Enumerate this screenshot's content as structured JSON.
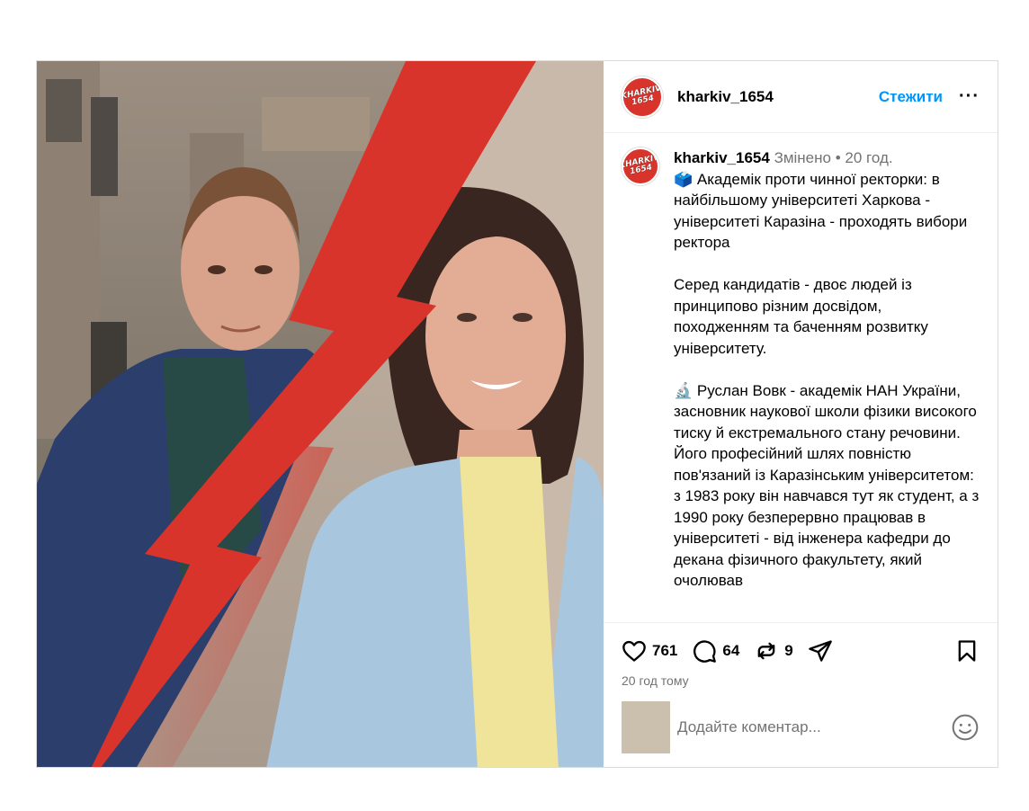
{
  "post": {
    "username": "kharkiv_1654",
    "follow_label": "Стежити",
    "more_label": "···",
    "avatar_text": "KHARKIV 1654",
    "caption": {
      "username": "kharkiv_1654",
      "edited": "Змінено",
      "separator": "•",
      "time": "20 год.",
      "emoji1": "🗳️",
      "paragraph1": " Академік проти чинної ректорки: в найбільшому університеті Харкова - університеті Каразіна - проходять вибори ректора",
      "paragraph2": "Серед кандидатів - двоє людей із принципово різним досвідом, походженням та баченням розвитку університету.",
      "emoji2": "🔬",
      "paragraph3": " Руслан Вовк - академік НАН України, засновник наукової школи фізики високого тиску й екстремального стану речовини. Його професійний шлях повністю пов'язаний із Каразінським університетом: з 1983 року він навчався тут як студент, а з 1990 року безперервно працював в університеті - від інженера кафедри до декана фізичного факультету, який очолював"
    },
    "likes": "761",
    "comments": "64",
    "reposts": "9",
    "time_ago": "20 год тому",
    "comment_placeholder": "Додайте коментар..."
  },
  "colors": {
    "accent": "#0095f6",
    "bolt": "#d9342b",
    "muted": "#737373"
  },
  "icons": [
    "heart-icon",
    "comment-icon",
    "repost-icon",
    "share-icon",
    "bookmark-icon",
    "emoji-icon"
  ]
}
